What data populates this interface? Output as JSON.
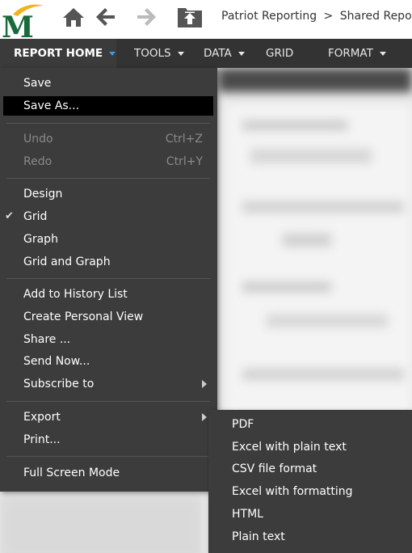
{
  "header": {
    "logo_letter": "M",
    "breadcrumb": [
      "Patriot Reporting",
      "Shared Reports"
    ],
    "breadcrumb_separator": ">"
  },
  "menubar": {
    "items": [
      {
        "label": "REPORT HOME",
        "active": true
      },
      {
        "label": "TOOLS"
      },
      {
        "label": "DATA"
      },
      {
        "label": "GRID"
      },
      {
        "label": "FORMAT"
      }
    ]
  },
  "report_menu": {
    "items": [
      {
        "label": "Save"
      },
      {
        "label": "Save As...",
        "selected": true
      },
      {
        "label": "Undo",
        "shortcut": "Ctrl+Z",
        "disabled": true
      },
      {
        "label": "Redo",
        "shortcut": "Ctrl+Y",
        "disabled": true
      },
      {
        "label": "Design"
      },
      {
        "label": "Grid",
        "checked": true
      },
      {
        "label": "Graph"
      },
      {
        "label": "Grid and Graph"
      },
      {
        "label": "Add to History List"
      },
      {
        "label": "Create Personal View"
      },
      {
        "label": "Share ..."
      },
      {
        "label": "Send Now..."
      },
      {
        "label": "Subscribe to",
        "submenu": true
      },
      {
        "label": "Export",
        "submenu": true
      },
      {
        "label": "Print..."
      },
      {
        "label": "Full Screen Mode"
      }
    ]
  },
  "export_submenu": {
    "items": [
      "PDF",
      "Excel with plain text",
      "CSV file format",
      "Excel with formatting",
      "HTML",
      "Plain text"
    ]
  },
  "colors": {
    "menubar_bg": "#333333",
    "menu_bg": "#3c3c3c",
    "selected_bg": "#000000",
    "active_caret": "#3d9be9",
    "logo_green": "#1a6b3c",
    "logo_gold": "#f2b21c"
  }
}
